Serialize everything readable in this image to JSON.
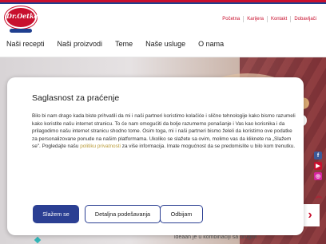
{
  "brand": {
    "logo_text": "Dr.Oetker"
  },
  "top_links": [
    "Početna",
    "Karijera",
    "Kontakt",
    "Dobavljači"
  ],
  "nav": [
    "Naši recepti",
    "Naši proizvodi",
    "Teme",
    "Naše usluge",
    "O nama"
  ],
  "hero": {
    "footer_text": "ideaan je u kombinaciji sa drugim"
  },
  "consent": {
    "title": "Saglasnost za praćenje",
    "text_before_link": "Bilo bi nam drago kada biste prihvatili da mi i naši partneri koristimo kolačiće i slične tehnologije kako bismo razumeli kako koristite našu internet stranicu. To će nam omogućiti da bolje razumemo ponašanje i Vas kao korisnika i da prilagodimo našu internet stranicu shodno tome. Osim toga, mi i naši partneri bismo želeli da koristimo ove podatke za personalizovane ponude na našim platformama. Ukoliko se slažete sa ovim, molimo vas da kliknete na „Slažem se\". Pogledajte našu",
    "link_text": "politiku privatnosti",
    "text_after_link": "za više informacija. Imate mogućnost da se predomislite u bilo kom trenutku.",
    "buttons": {
      "accept": "Slažem se",
      "details": "Detaljna podešavanja",
      "reject": "Odbijam"
    }
  },
  "colors": {
    "brand_red": "#c8102e",
    "brand_blue": "#2b3f93"
  },
  "icons": [
    "facebook-icon",
    "youtube-icon",
    "instagram-icon",
    "chevron-right-icon"
  ]
}
